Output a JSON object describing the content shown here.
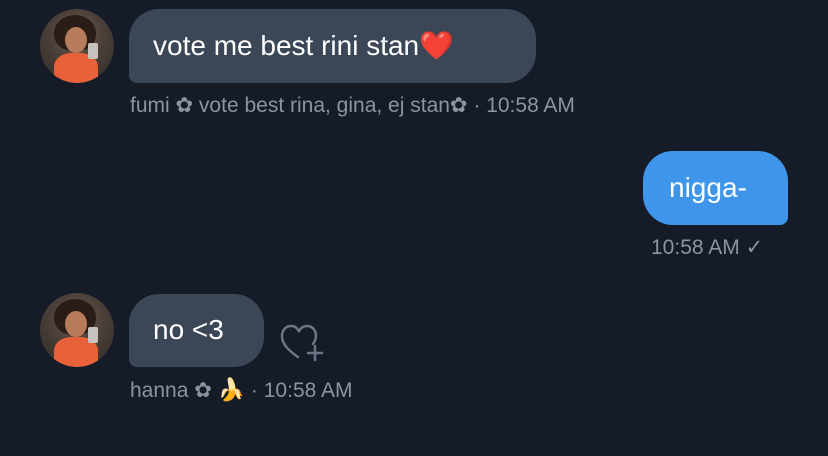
{
  "messages": [
    {
      "sender": "fumi ✿ vote best rina, gina, ej stan✿",
      "text": "vote me best rini stan",
      "emoji": "❤️",
      "time": "· 10:58 AM"
    },
    {
      "text": "nigga-",
      "time": "10:58 AM",
      "status": "✓"
    },
    {
      "sender": "hanna ✿",
      "sender_emoji": "🍌",
      "text": "no <3",
      "time": "· 10:58 AM"
    }
  ],
  "icons": {
    "react": "heart-plus-icon",
    "avatar": "profile-photo"
  },
  "colors": {
    "background": "#151c28",
    "incoming_bubble": "#3b4656",
    "outgoing_bubble": "#3f95ea",
    "meta_text": "#8a94a3"
  }
}
